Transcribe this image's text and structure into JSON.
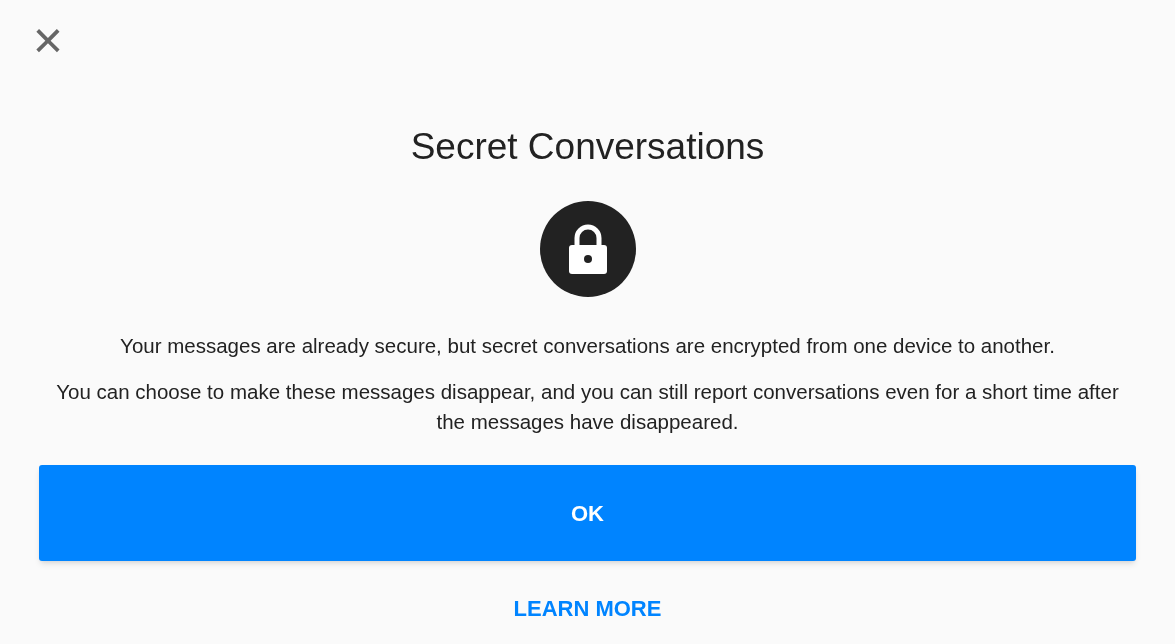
{
  "close_button": {
    "label": "×"
  },
  "title": "Secret Conversations",
  "paragraphs": [
    "Your messages are already secure, but secret conversations are encrypted from one device to another.",
    "You can choose to make these messages disappear, and you can still report conversations even for a short time after the messages have disappeared."
  ],
  "buttons": [
    {
      "label": "OK",
      "kind": "primary"
    },
    {
      "label": "LEARN MORE",
      "kind": "link"
    }
  ]
}
